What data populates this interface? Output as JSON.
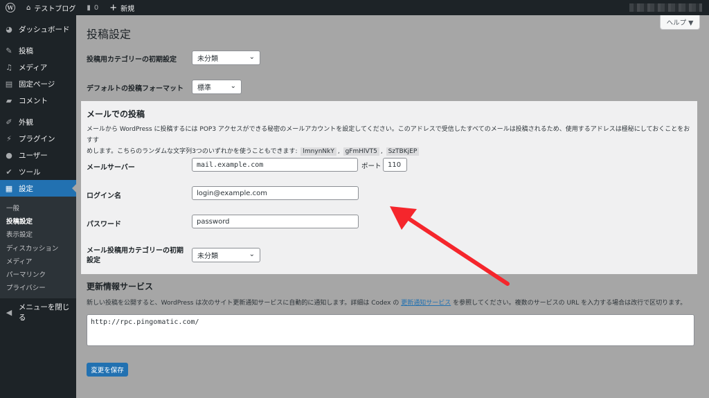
{
  "adminbar": {
    "site_name": "テストブログ",
    "comments_count": "0",
    "new_label": "新規"
  },
  "sidebar": {
    "items": [
      {
        "label": "ダッシュボード",
        "icon": "dashboard-icon"
      },
      {
        "label": "投稿",
        "icon": "pin-icon"
      },
      {
        "label": "メディア",
        "icon": "media-icon"
      },
      {
        "label": "固定ページ",
        "icon": "page-icon"
      },
      {
        "label": "コメント",
        "icon": "comment-icon"
      },
      {
        "label": "外観",
        "icon": "brush-icon"
      },
      {
        "label": "プラグイン",
        "icon": "plugin-icon"
      },
      {
        "label": "ユーザー",
        "icon": "user-icon"
      },
      {
        "label": "ツール",
        "icon": "wrench-icon"
      },
      {
        "label": "設定",
        "icon": "settings-icon"
      }
    ],
    "submenu": [
      "一般",
      "投稿設定",
      "表示設定",
      "ディスカッション",
      "メディア",
      "パーマリンク",
      "プライバシー"
    ],
    "collapse_label": "メニューを閉じる"
  },
  "header": {
    "help_label": "ヘルプ ▼",
    "page_title": "投稿設定"
  },
  "form": {
    "default_category_label": "投稿用カテゴリーの初期設定",
    "default_category_value": "未分類",
    "default_format_label": "デフォルトの投稿フォーマット",
    "default_format_value": "標準"
  },
  "email": {
    "title": "メールでの投稿",
    "desc_line1": "メールから WordPress に投稿するには POP3 アクセスができる秘密のメールアカウントを設定してください。このアドレスで受信したすべてのメールは投稿されるため、使用するアドレスは極秘にしておくことをおすす",
    "desc_line2": "めします。こちらのランダムな文字列3つのいずれかを使うこともできます:",
    "codes": [
      "lmnynNkY",
      "gFmHlVT5",
      "SzTBKjEP"
    ],
    "server_label": "メールサーバー",
    "server_value": "mail.example.com",
    "port_label": "ポート",
    "port_value": "110",
    "login_label": "ログイン名",
    "login_value": "login@example.com",
    "password_label": "パスワード",
    "password_value": "password",
    "category_label_1": "メール投稿用カテゴリーの初期",
    "category_label_2": "設定",
    "category_value": "未分類"
  },
  "update_services": {
    "title": "更新情報サービス",
    "desc_before": "新しい投稿を公開すると、WordPress は次のサイト更新通知サービスに自動的に通知します。詳細は Codex の",
    "desc_link": "更新通知サービス",
    "desc_after": "を参照してください。複数のサービスの URL を入力する場合は改行で区切ります。",
    "textarea_value": "http://rpc.pingomatic.com/"
  },
  "save_label": "変更を保存",
  "colors": {
    "accent": "#2271b1",
    "arrow": "#f5262c",
    "sidebar_bg": "#1d2327"
  }
}
